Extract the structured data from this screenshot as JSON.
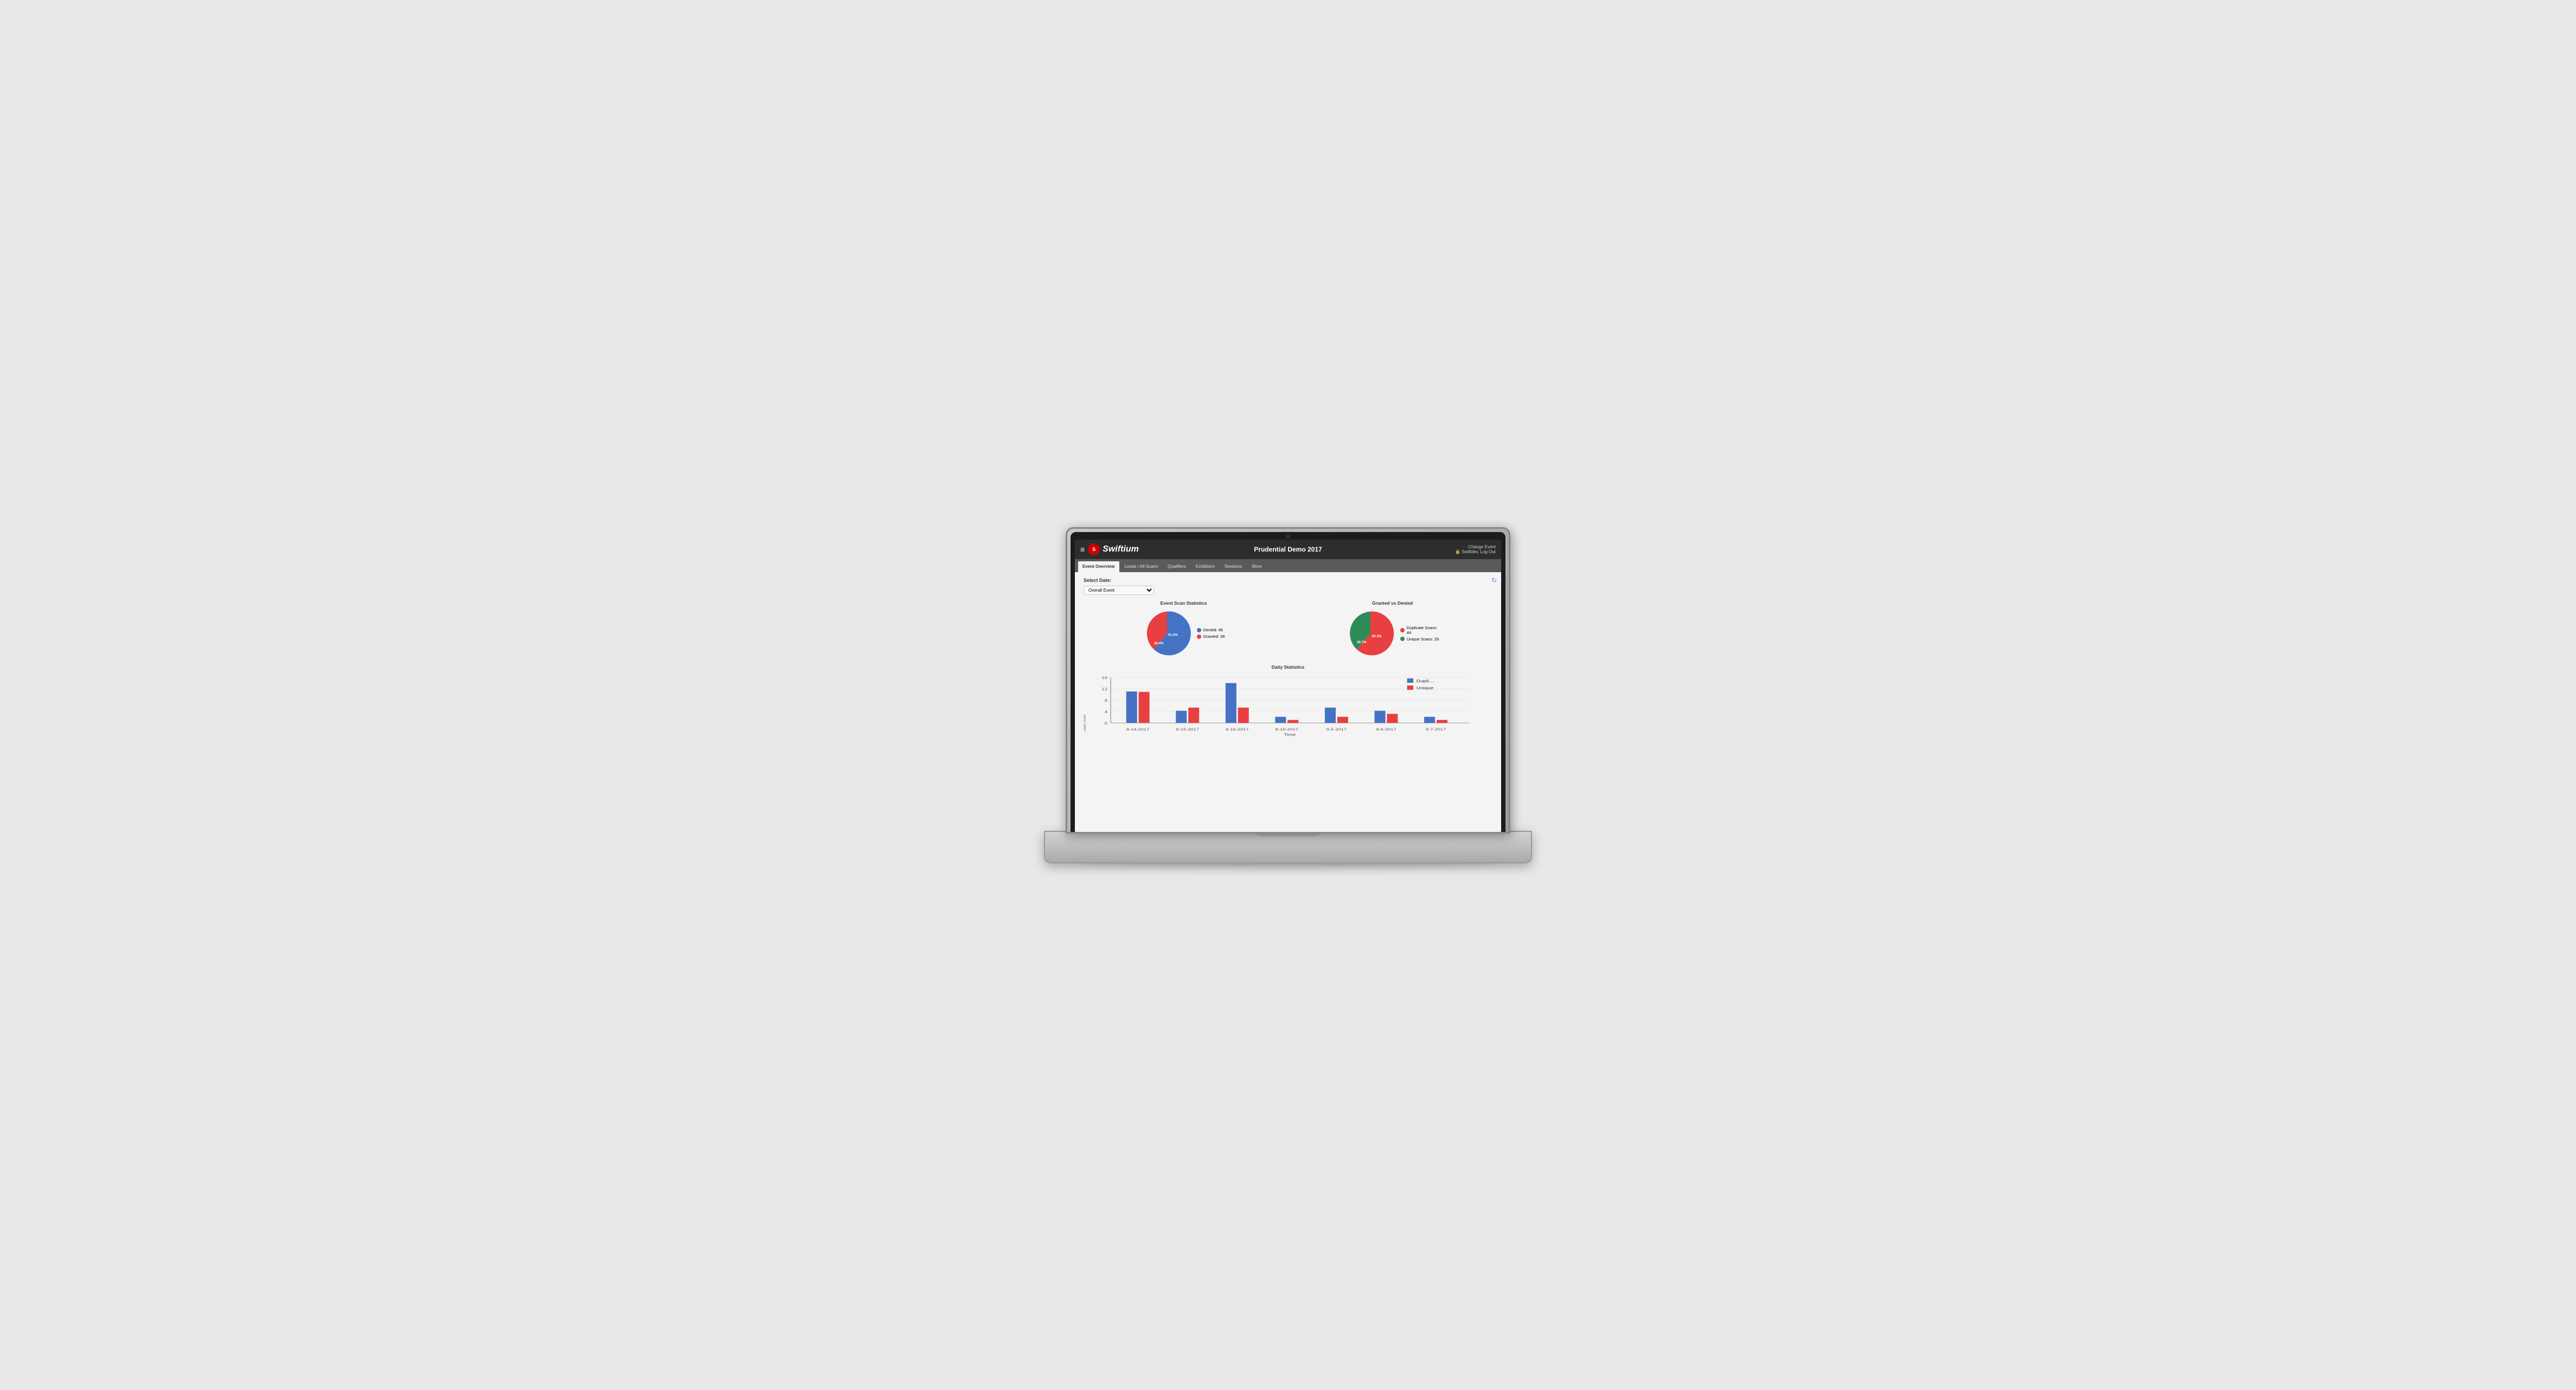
{
  "header": {
    "menu_label": "≡",
    "logo_icon": "S",
    "logo_text": "Swiftium",
    "event_title": "Prudential Demo 2017",
    "change_event": "Change Event",
    "logout": "🔒 Swiftdev, Log Out"
  },
  "nav": {
    "tabs": [
      {
        "id": "event-overview",
        "label": "Event Overview",
        "active": true
      },
      {
        "id": "leads-all-scans",
        "label": "Leads / All Scans",
        "active": false
      },
      {
        "id": "qualifiers",
        "label": "Qualifiers",
        "active": false
      },
      {
        "id": "exhibitors",
        "label": "Exhibitors",
        "active": false
      },
      {
        "id": "sessions",
        "label": "Sessions",
        "active": false
      },
      {
        "id": "more",
        "label": "More",
        "active": false
      }
    ]
  },
  "content": {
    "select_date_label": "Select Date:",
    "date_option": "Overall Event",
    "refresh_icon": "↻",
    "event_scan_stats": {
      "title": "Event Scan Statistics",
      "denied_label": "Denied: 45",
      "granted_label": "Granted: 28",
      "denied_pct": "61.6%",
      "granted_pct": "38.4%",
      "denied_color": "#4472C4",
      "granted_color": "#E84040"
    },
    "granted_vs_denied": {
      "title": "Granted vs Denied",
      "duplicate_label": "Duplicate Scans:",
      "duplicate_count": "44",
      "unique_label": "Unique Scans: 29",
      "duplicate_pct": "60.3%",
      "unique_pct": "39.7%",
      "duplicate_color": "#E84040",
      "unique_color": "#2E8B57"
    },
    "daily_stats": {
      "title": "Daily Statistics",
      "y_axis_label": "Lead Count",
      "x_axis_label": "Time",
      "legend": [
        {
          "label": "Dupli…",
          "color": "#4472C4"
        },
        {
          "label": "Unique",
          "color": "#E84040"
        }
      ],
      "dates": [
        "8-14-2017",
        "8-15-2017",
        "8-16-2017",
        "8-19-2017",
        "9-5-2017",
        "9-6-2017",
        "9-7-2017"
      ],
      "duplicate_values": [
        10,
        4,
        13,
        2,
        5,
        4,
        2
      ],
      "unique_values": [
        9,
        5,
        5,
        1,
        2,
        3,
        1
      ],
      "y_max": 16,
      "y_ticks": [
        0,
        4,
        8,
        12,
        16
      ]
    }
  }
}
